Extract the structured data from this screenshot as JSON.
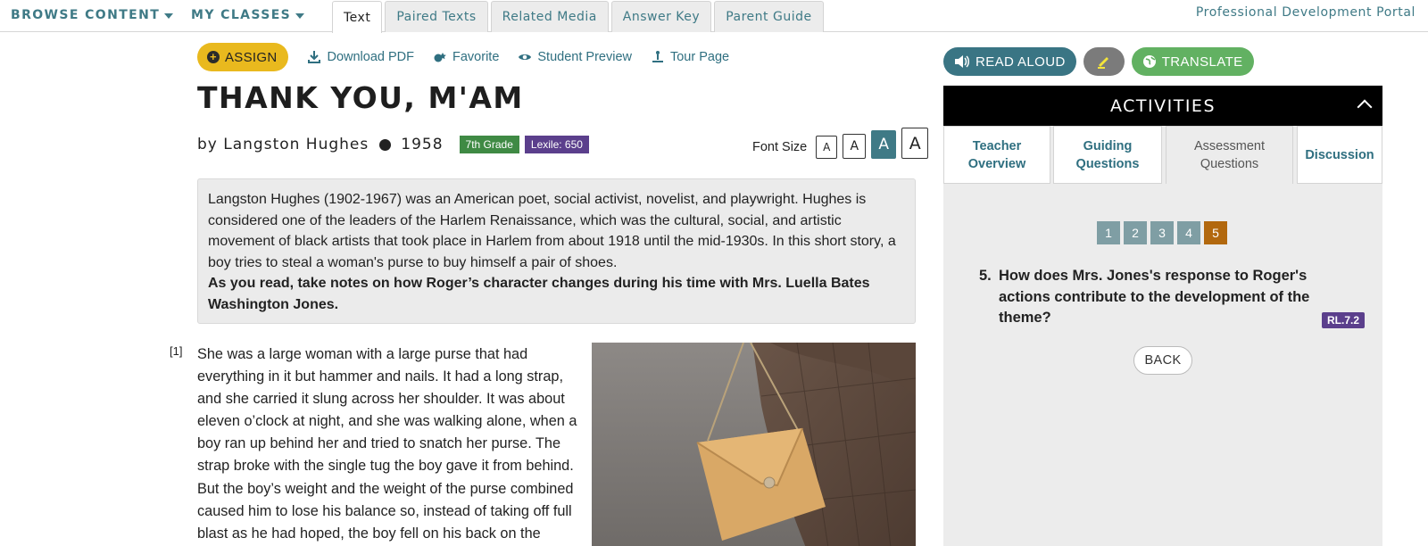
{
  "nav": {
    "browse": "BROWSE CONTENT",
    "classes": "MY CLASSES",
    "tabs": [
      "Text",
      "Paired Texts",
      "Related Media",
      "Answer Key",
      "Parent Guide"
    ],
    "portal": "Professional Development Portal"
  },
  "toolbar": {
    "assign": "ASSIGN",
    "download": "Download PDF",
    "favorite": "Favorite",
    "preview": "Student Preview",
    "tour": "Tour Page"
  },
  "text": {
    "title": "THANK YOU, M'AM",
    "author": "by Langston Hughes",
    "year": "1958",
    "grade": "7th Grade",
    "lexile": "Lexile: 650",
    "font_size_label": "Font Size",
    "font_buttons": [
      "A",
      "A",
      "A",
      "A"
    ],
    "intro": "Langston Hughes (1902-1967) was an American poet, social activist, novelist, and playwright. Hughes is considered one of the leaders of the Harlem Renaissance, which was the cultural, social, and artistic movement of black artists that took place in Harlem from about 1918 until the mid-1930s. In this short story, a boy tries to steal a woman's purse to buy himself a pair of shoes.",
    "intro_bold": "As you read, take notes on how Roger’s character changes during his time with Mrs. Luella Bates Washington Jones.",
    "para_num": "[1]",
    "story": "She was a large woman with a large purse that had everything in it but hammer and nails. It had a long strap, and she carried it slung across her shoulder. It was about eleven o’clock at night, and she was walking alone, when a boy ran up behind her and tried to snatch her purse. The strap broke with the single tug the boy gave it from behind. But the boy’s weight and the weight of the purse combined caused him to lose his balance so, instead of taking off full blast as he had hoped, the boy fell on his back on the"
  },
  "panel": {
    "read_aloud": "READ ALOUD",
    "translate": "TRANSLATE",
    "activities": "ACTIVITIES",
    "tabs": {
      "teacher": "Teacher Overview",
      "guiding": "Guiding Questions",
      "assessment": "Assessment Questions",
      "discussion": "Discussion"
    },
    "question_numbers": [
      "1",
      "2",
      "3",
      "4",
      "5"
    ],
    "active_question": "5",
    "question_num": "5.",
    "question": "How does Mrs. Jones's response to Roger's actions contribute to the development of the theme?",
    "standard": "RL.7.2",
    "back": "BACK"
  },
  "colors": {
    "teal": "#3f7a86",
    "assign": "#e9b91e",
    "grade_badge": "#3f8a44",
    "lexile_badge": "#5b3f8c",
    "translate": "#62b162",
    "active_question": "#b2680e"
  }
}
